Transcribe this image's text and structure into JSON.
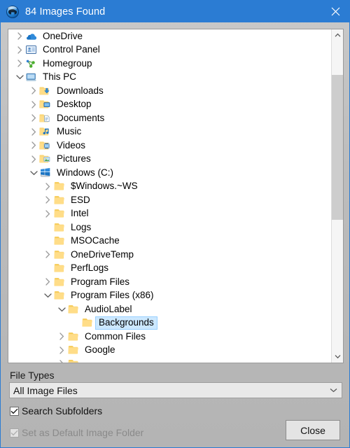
{
  "window": {
    "title": "84 Images Found",
    "app_icon": "audiolabel-sphere-icon",
    "close_icon": "close-icon",
    "titlebar_color": "#2b7cd3",
    "background_color": "#bcbcbc"
  },
  "tree": {
    "selection_color": "#cce8ff",
    "items": [
      {
        "label": "OneDrive",
        "depth": 0,
        "twisty": "collapsed",
        "icon": "onedrive-cloud-icon",
        "selected": false
      },
      {
        "label": "Control Panel",
        "depth": 0,
        "twisty": "collapsed",
        "icon": "control-panel-icon",
        "selected": false
      },
      {
        "label": "Homegroup",
        "depth": 0,
        "twisty": "collapsed",
        "icon": "homegroup-icon",
        "selected": false
      },
      {
        "label": "This PC",
        "depth": 0,
        "twisty": "expanded",
        "icon": "this-pc-icon",
        "selected": false
      },
      {
        "label": "Downloads",
        "depth": 1,
        "twisty": "collapsed",
        "icon": "downloads-folder-icon",
        "selected": false
      },
      {
        "label": "Desktop",
        "depth": 1,
        "twisty": "collapsed",
        "icon": "desktop-folder-icon",
        "selected": false
      },
      {
        "label": "Documents",
        "depth": 1,
        "twisty": "collapsed",
        "icon": "documents-folder-icon",
        "selected": false
      },
      {
        "label": "Music",
        "depth": 1,
        "twisty": "collapsed",
        "icon": "music-folder-icon",
        "selected": false
      },
      {
        "label": "Videos",
        "depth": 1,
        "twisty": "collapsed",
        "icon": "videos-folder-icon",
        "selected": false
      },
      {
        "label": "Pictures",
        "depth": 1,
        "twisty": "collapsed",
        "icon": "pictures-folder-icon",
        "selected": false
      },
      {
        "label": "Windows (C:)",
        "depth": 1,
        "twisty": "expanded",
        "icon": "windows-drive-icon",
        "selected": false
      },
      {
        "label": "$Windows.~WS",
        "depth": 2,
        "twisty": "collapsed",
        "icon": "folder-icon",
        "selected": false
      },
      {
        "label": "ESD",
        "depth": 2,
        "twisty": "collapsed",
        "icon": "folder-icon",
        "selected": false
      },
      {
        "label": "Intel",
        "depth": 2,
        "twisty": "collapsed",
        "icon": "folder-icon",
        "selected": false
      },
      {
        "label": "Logs",
        "depth": 2,
        "twisty": "none",
        "icon": "folder-icon",
        "selected": false
      },
      {
        "label": "MSOCache",
        "depth": 2,
        "twisty": "none",
        "icon": "folder-icon",
        "selected": false
      },
      {
        "label": "OneDriveTemp",
        "depth": 2,
        "twisty": "collapsed",
        "icon": "folder-icon",
        "selected": false
      },
      {
        "label": "PerfLogs",
        "depth": 2,
        "twisty": "none",
        "icon": "folder-icon",
        "selected": false
      },
      {
        "label": "Program Files",
        "depth": 2,
        "twisty": "collapsed",
        "icon": "folder-icon",
        "selected": false
      },
      {
        "label": "Program Files (x86)",
        "depth": 2,
        "twisty": "expanded",
        "icon": "folder-icon",
        "selected": false
      },
      {
        "label": "AudioLabel",
        "depth": 3,
        "twisty": "expanded",
        "icon": "folder-icon",
        "selected": false
      },
      {
        "label": "Backgrounds",
        "depth": 4,
        "twisty": "none",
        "icon": "folder-icon",
        "selected": true
      },
      {
        "label": "Common Files",
        "depth": 3,
        "twisty": "collapsed",
        "icon": "folder-icon",
        "selected": false
      },
      {
        "label": "Google",
        "depth": 3,
        "twisty": "collapsed",
        "icon": "folder-icon",
        "selected": false
      },
      {
        "label": "",
        "depth": 3,
        "twisty": "collapsed",
        "icon": "folder-icon",
        "selected": false
      }
    ],
    "scrollbar": {
      "up_icon": "chevron-up-icon",
      "down_icon": "chevron-down-icon"
    }
  },
  "controls": {
    "file_types_label": "File Types",
    "file_types_value": "All Image Files",
    "file_types_caret_icon": "chevron-down-icon",
    "search_subfolders_label": "Search Subfolders",
    "search_subfolders_checked": true,
    "set_default_label": "Set as Default Image Folder",
    "set_default_checked": true,
    "set_default_disabled": true,
    "close_button_label": "Close"
  }
}
